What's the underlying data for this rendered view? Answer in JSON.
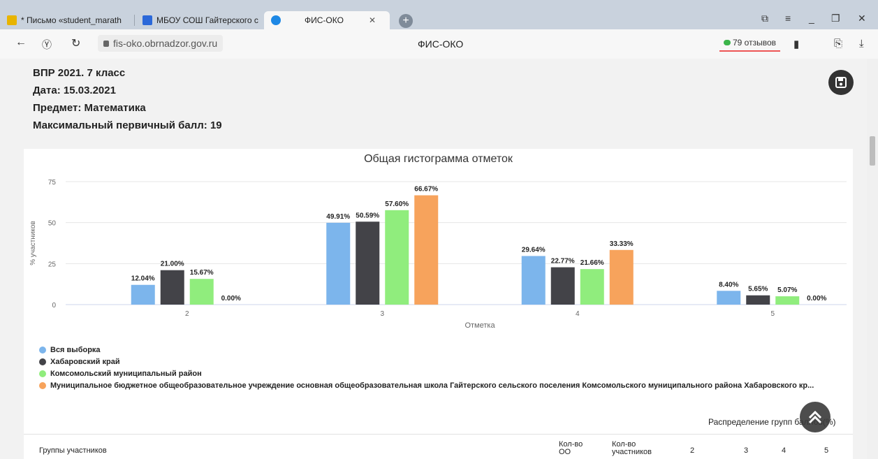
{
  "browser": {
    "tabs": [
      {
        "label": "* Письмо «student_marath",
        "color": "#e8b400"
      },
      {
        "label": "МБОУ СОШ Гайтерского с",
        "color": "#2b68d9"
      },
      {
        "label": "ФИС-ОКО",
        "color": "#1e88e5"
      }
    ],
    "url": "fis-oko.obrnadzor.gov.ru",
    "title": "ФИС-ОКО",
    "reviews": "79 отзывов"
  },
  "report": {
    "line1": "ВПР 2021. 7 класс",
    "line2": "Дата: 15.03.2021",
    "line3": "Предмет: Математика",
    "line4": "Максимальный первичный балл: 19"
  },
  "chart_data": {
    "type": "bar",
    "title": "Общая гистограмма отметок",
    "xlabel": "Отметка",
    "ylabel": "% участников",
    "ylim": [
      0,
      75
    ],
    "yticks": [
      0,
      25,
      50,
      75
    ],
    "categories": [
      "2",
      "3",
      "4",
      "5"
    ],
    "series": [
      {
        "name": "Вся выборка",
        "color": "#7cb5ec",
        "values": [
          12.04,
          49.91,
          29.64,
          8.4
        ],
        "labels": [
          "12.04%",
          "49.91%",
          "29.64%",
          "8.40%"
        ]
      },
      {
        "name": "Хабаровский край",
        "color": "#434348",
        "values": [
          21.0,
          50.59,
          22.77,
          5.65
        ],
        "labels": [
          "21.00%",
          "50.59%",
          "22.77%",
          "5.65%"
        ]
      },
      {
        "name": "Комсомольский муниципальный район",
        "color": "#90ed7d",
        "values": [
          15.67,
          57.6,
          21.66,
          5.07
        ],
        "labels": [
          "15.67%",
          "57.60%",
          "21.66%",
          "5.07%"
        ]
      },
      {
        "name": "Муниципальное бюджетное общеобразовательное учреждение основная общеобразовательная школа Гайтерского сельского поселения Комсомольского муниципального района Хабаровского кр...",
        "color": "#f7a35c",
        "values": [
          0.0,
          66.67,
          33.33,
          0.0
        ],
        "labels": [
          "0.00%",
          "66.67%",
          "33.33%",
          "0.00%"
        ]
      }
    ]
  },
  "table": {
    "dist_label": "Распределение групп баллов(%)",
    "col_groups": "Группы участников",
    "col_oo_1": "Кол-во",
    "col_oo_2": "ОО",
    "col_part_1": "Кол-во",
    "col_part_2": "участников",
    "col_2": "2",
    "col_3": "3",
    "col_4": "4",
    "col_5": "5"
  }
}
